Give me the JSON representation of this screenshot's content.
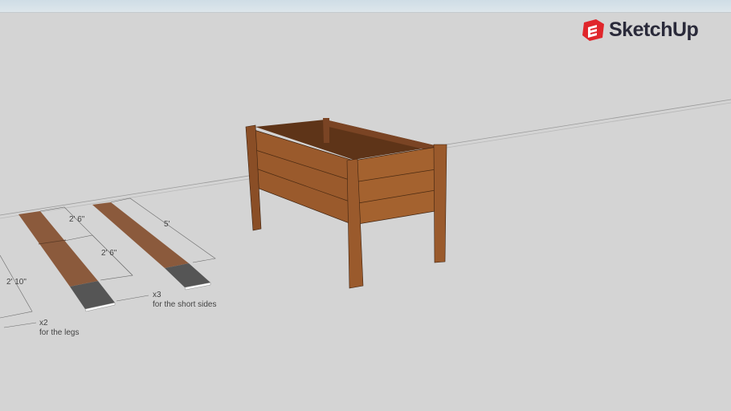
{
  "app": {
    "logo_text": "SketchUp",
    "brand_color": "#e0262b"
  },
  "annotations": {
    "dim_leg_length": "2' 10\"",
    "dim_long_half_1": "2' 6\"",
    "dim_long_half_2": "2' 6\"",
    "dim_short_board": "5'",
    "count_short_sides": "x3",
    "note_short_sides": "for the short sides",
    "count_legs": "x2",
    "note_legs": "for the legs"
  },
  "colors": {
    "wood": "#8b5a3c",
    "wood_dark": "#6e3e1e",
    "cut": "#555555",
    "background": "#d4d4d4"
  }
}
